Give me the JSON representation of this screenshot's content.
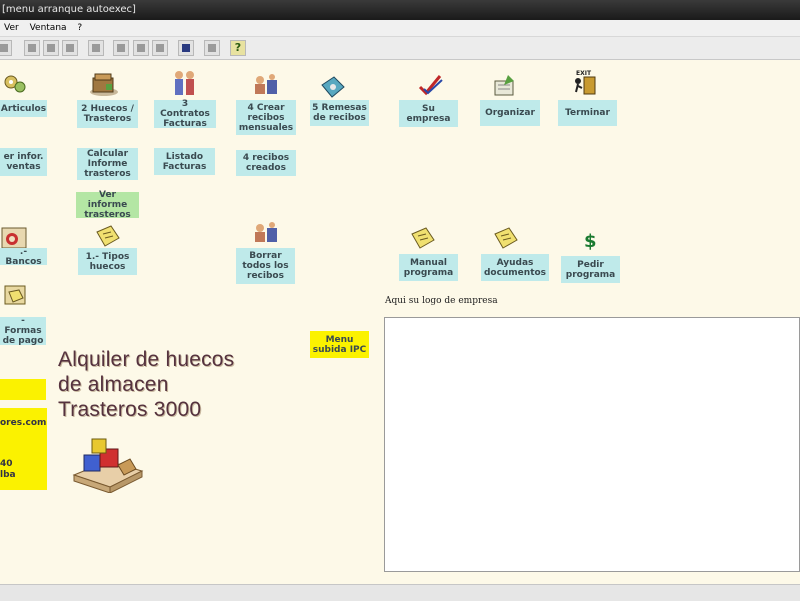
{
  "window": {
    "title": "[menu arranque autoexec]"
  },
  "menu": {
    "items": [
      "Ver",
      "Ventana",
      "?"
    ]
  },
  "toolbar": {
    "help_label": "?"
  },
  "buttons": {
    "articulos": "Articulos",
    "huecos": "2 Huecos /\nTrasteros",
    "contratos": "3 Contratos\nFacturas",
    "crear_recibos": "4 Crear\nrecibos\nmensuales",
    "remesas": "5 Remesas\nde recibos",
    "su_empresa": "Su\nempresa",
    "organizar": "Organizar",
    "terminar": "Terminar",
    "ver_infor_ventas": "er infor.\nventas",
    "calcular_informe": "Calcular\nInforme\ntrasteros",
    "listado_facturas": "Listado\nFacturas",
    "recibos_creados": "4 recibos\ncreados",
    "ver_informe_trasteros": "Ver informe\ntrasteros",
    "bancos": ".- Bancos",
    "tipos_huecos": "1.- Tipos\nhuecos",
    "borrar_recibos": "Borrar\ntodos los\nrecibos",
    "manual_programa": "Manual\nprograma",
    "ayudas_documentos": "Ayudas\ndocumentos",
    "pedir_programa": "Pedir\nprograma",
    "formas_pago": "- Formas\nde pago",
    "menu_subida_ipc": "Menu\nsubida IPC"
  },
  "app_title": {
    "line1": "Alquiler de huecos",
    "line2": "de almacen",
    "line3": "Trasteros  3000"
  },
  "logo_area": {
    "label": "Aqui su logo de empresa"
  },
  "side_panel": {
    "line1": "ores.com",
    "line2": "40",
    "line3": "lba"
  },
  "colors": {
    "button": "#bfeaea",
    "button_green": "#b4e6a4",
    "highlight_yellow": "#fbf200",
    "title_text": "#55323e"
  }
}
